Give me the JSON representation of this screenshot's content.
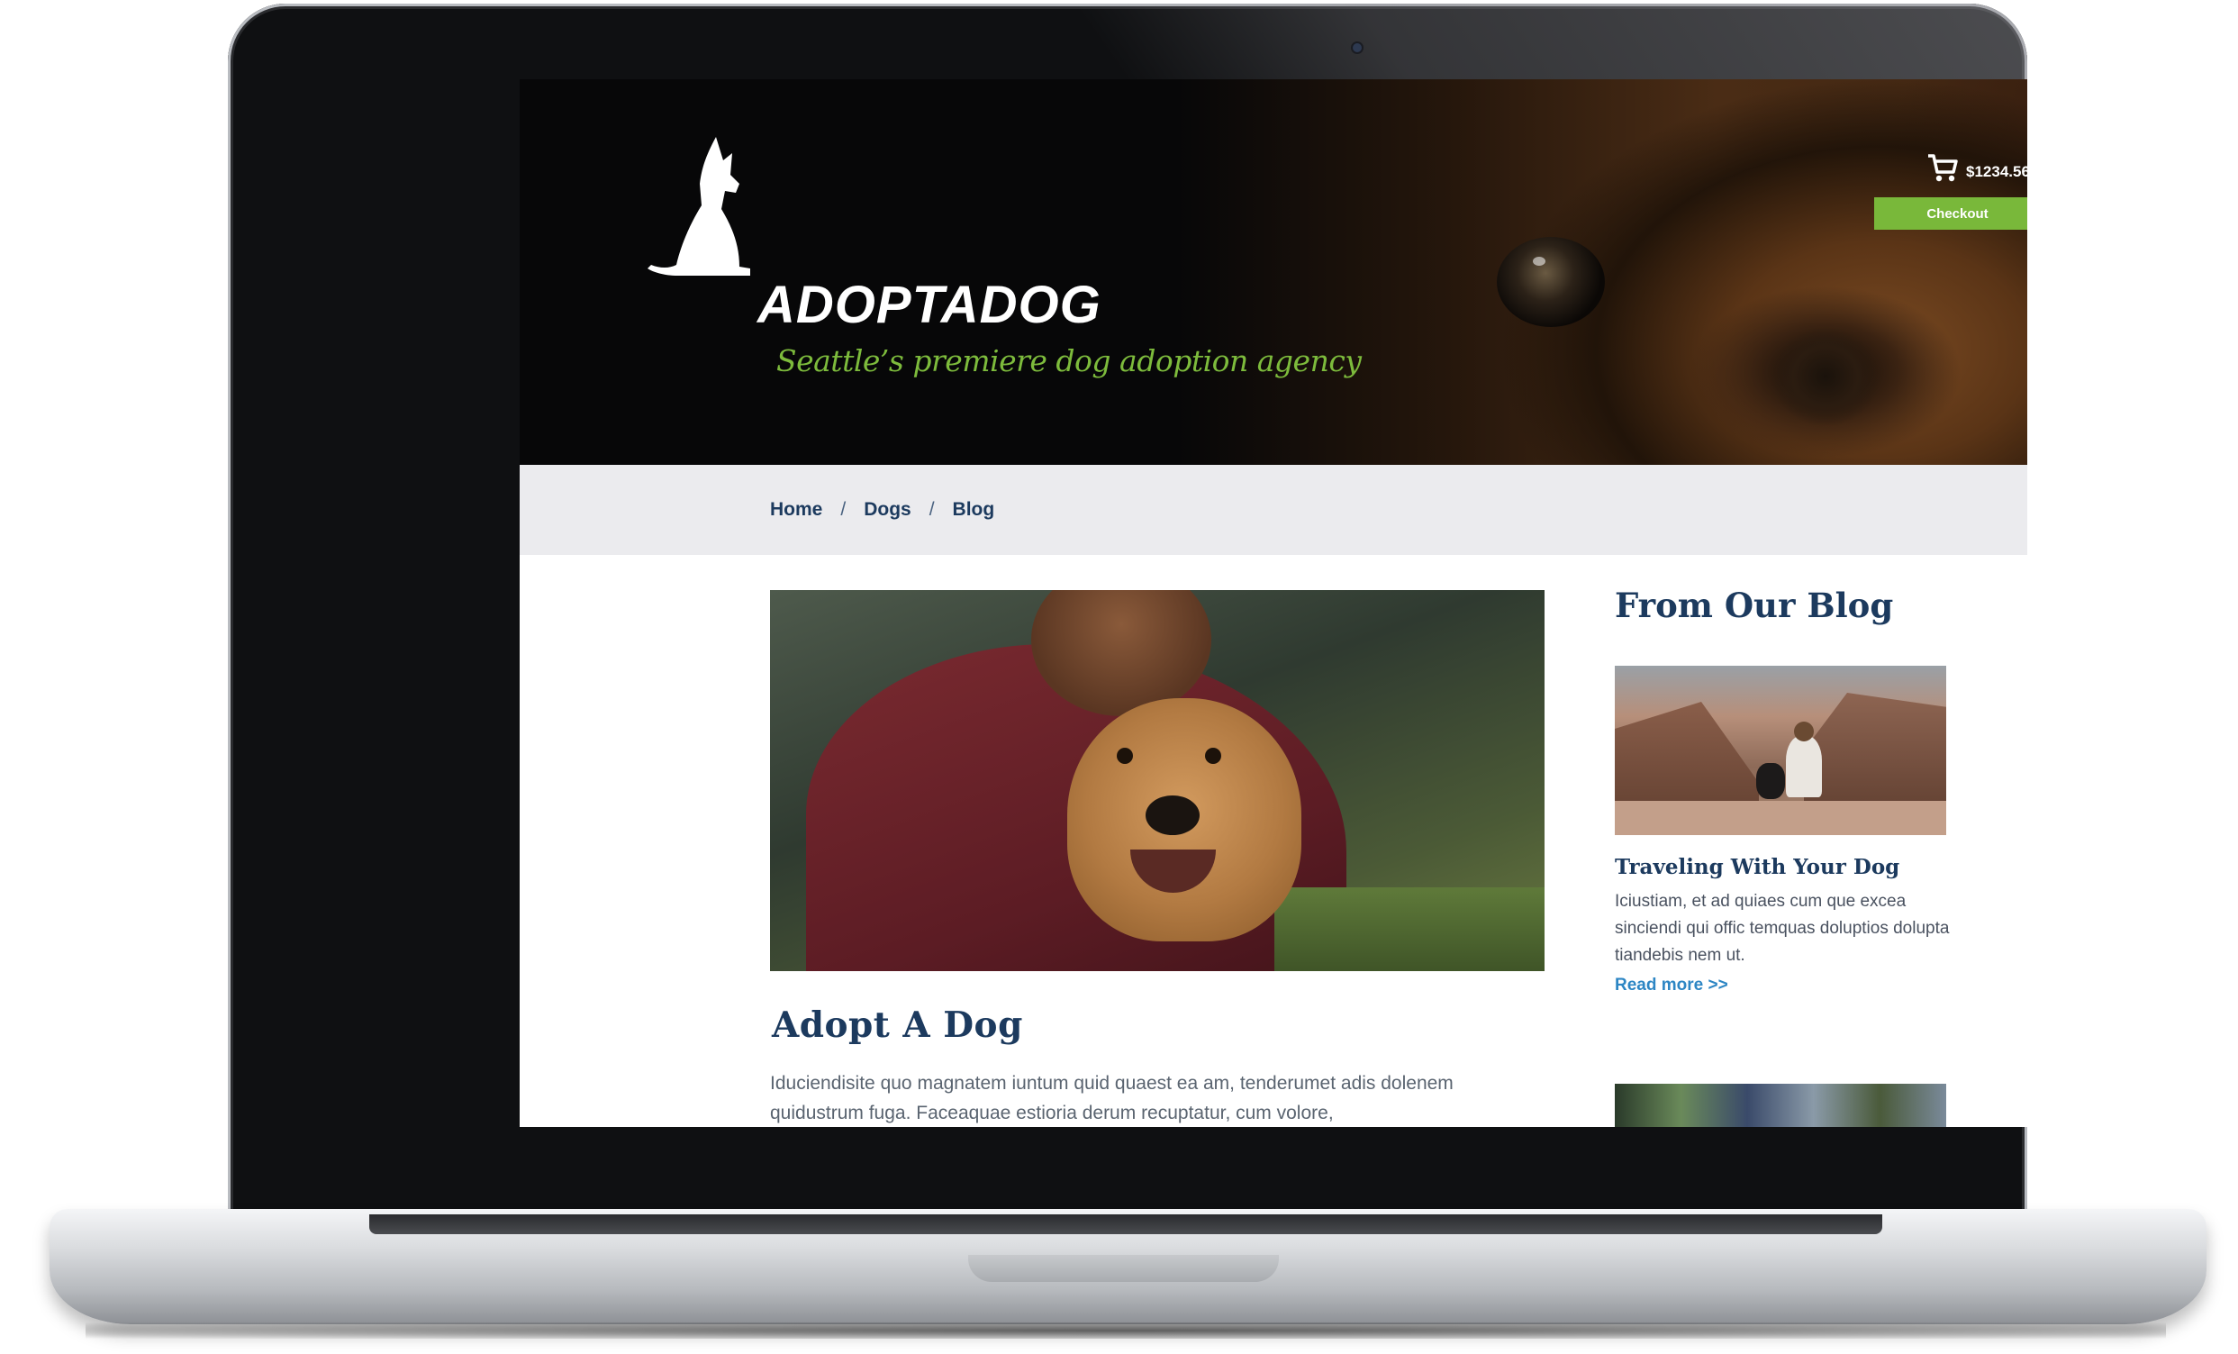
{
  "header": {
    "brand": "ADOPTADOG",
    "tagline": "Seattle’s premiere dog adoption agency",
    "cart_total": "$1234.56",
    "checkout_label": "Checkout"
  },
  "breadcrumb": {
    "items": [
      "Home",
      "Dogs",
      "Blog"
    ],
    "separator": "/"
  },
  "article": {
    "title": "Adopt A Dog",
    "body": "Iduciendisite quo magnatem iuntum quid quaest ea am, tenderumet adis dolenem quidustrum fuga. Faceaquae estioria derum recuptatur, cum volore,"
  },
  "sidebar": {
    "title": "From Our Blog",
    "posts": [
      {
        "title": "Traveling With Your Dog",
        "excerpt": "Iciustiam, et ad quiaes cum que excea sinciendi qui offic temquas doluptios dolupta tiandebis nem ut.",
        "read_more": "Read more >>"
      }
    ]
  },
  "colors": {
    "accent_green": "#79b83a",
    "navy": "#1c3a5e",
    "link_blue": "#2d86c4",
    "crumb_bg": "#ebebee"
  },
  "icons": [
    "dog-silhouette-icon",
    "cart-icon"
  ]
}
